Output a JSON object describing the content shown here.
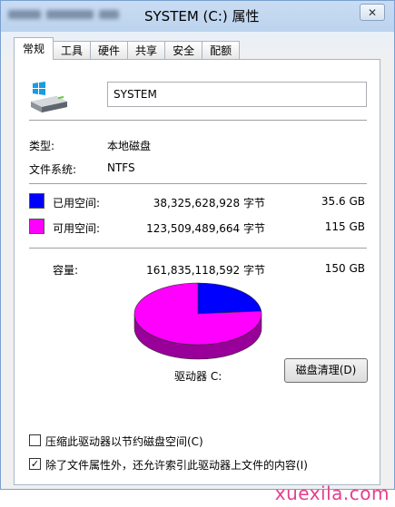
{
  "window": {
    "title": "SYSTEM (C:) 属性",
    "close_symbol": "✕"
  },
  "tabs": [
    {
      "label": "常规",
      "active": true
    },
    {
      "label": "工具"
    },
    {
      "label": "硬件"
    },
    {
      "label": "共享"
    },
    {
      "label": "安全"
    },
    {
      "label": "配额"
    }
  ],
  "general": {
    "volume_name": "SYSTEM",
    "type_label": "类型:",
    "type_value": "本地磁盘",
    "fs_label": "文件系统:",
    "fs_value": "NTFS",
    "used": {
      "label": "已用空间:",
      "bytes": "38,325,628,928 字节",
      "size": "35.6 GB",
      "color": "#0000ff"
    },
    "free": {
      "label": "可用空间:",
      "bytes": "123,509,489,664 字节",
      "size": "115 GB",
      "color": "#ff00ff"
    },
    "capacity": {
      "label": "容量:",
      "bytes": "161,835,118,592 字节",
      "size": "150 GB"
    },
    "drive_label": "驱动器 C:",
    "cleanup_button": "磁盘清理(D)",
    "compress_checkbox": {
      "label": "压缩此驱动器以节约磁盘空间(C)",
      "checked": false
    },
    "index_checkbox": {
      "label": "除了文件属性外，还允许索引此驱动器上文件的内容(I)",
      "checked": true
    }
  },
  "chart_data": {
    "type": "pie",
    "slices": [
      {
        "label": "已用空间",
        "value": 35.6,
        "color": "#0000ff"
      },
      {
        "label": "可用空间",
        "value": 115,
        "color": "#ff00ff"
      }
    ]
  },
  "watermark": "xuexila.com"
}
